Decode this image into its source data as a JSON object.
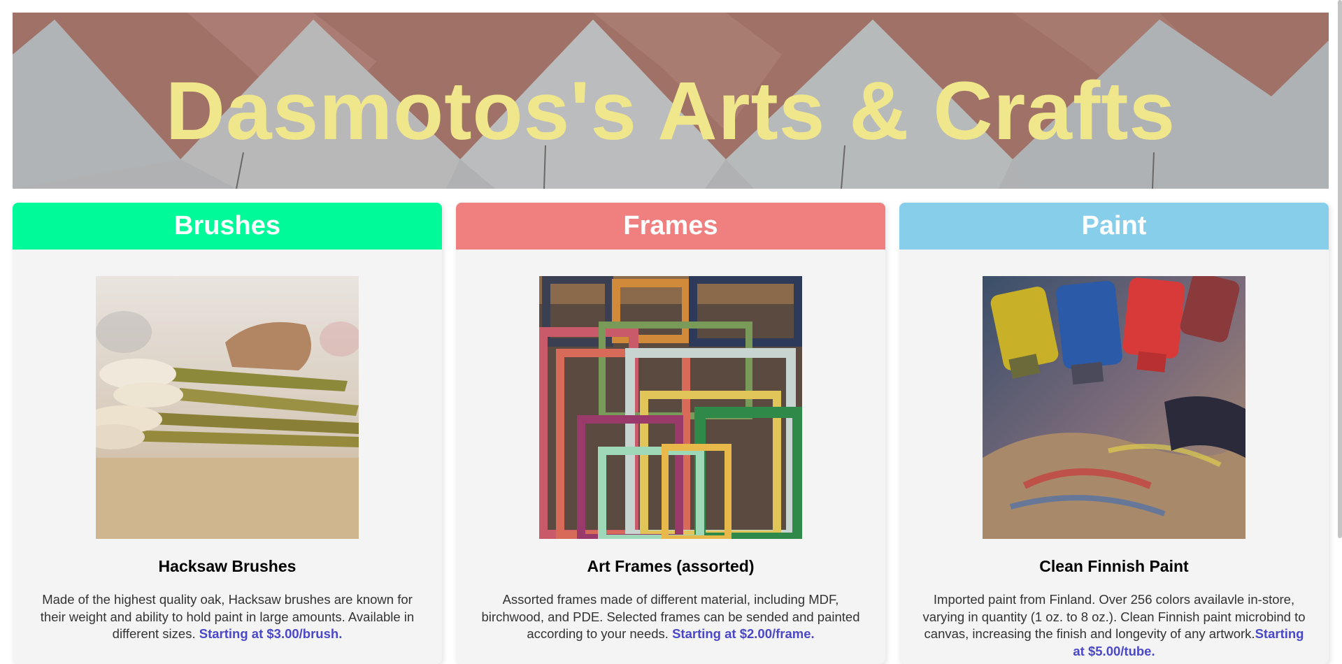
{
  "header": {
    "title": "Dasmotos's Arts & Crafts",
    "title_color": "#f0e68c"
  },
  "cards": [
    {
      "heading": "Brushes",
      "heading_bg": "#00fa9a",
      "image": "brushes-photo",
      "product_name": "Hacksaw Brushes",
      "description": "Made of the highest quality oak, Hacksaw brushes are known for their weight and ability to hold paint in large amounts. Available in different sizes. ",
      "price_text": "Starting at $3.00/brush."
    },
    {
      "heading": "Frames",
      "heading_bg": "#f08080",
      "image": "frames-photo",
      "product_name": "Art Frames (assorted)",
      "description": "Assorted frames made of different material, including MDF, birchwood, and PDE. Selected frames can be sended and painted according to your needs. ",
      "price_text": "Starting at $2.00/frame."
    },
    {
      "heading": "Paint",
      "heading_bg": "#87ceeb",
      "image": "paint-photo",
      "product_name": "Clean Finnish Paint",
      "description": "Imported paint from Finland. Over 256 colors availavle in-store, varying in quantity (1 oz. to 8 oz.). Clean Finnish paint microbind to canvas, increasing the finish and longevity of any artwork.",
      "price_text": "Starting at $5.00/tube."
    }
  ],
  "price_color": "#4a48c8"
}
